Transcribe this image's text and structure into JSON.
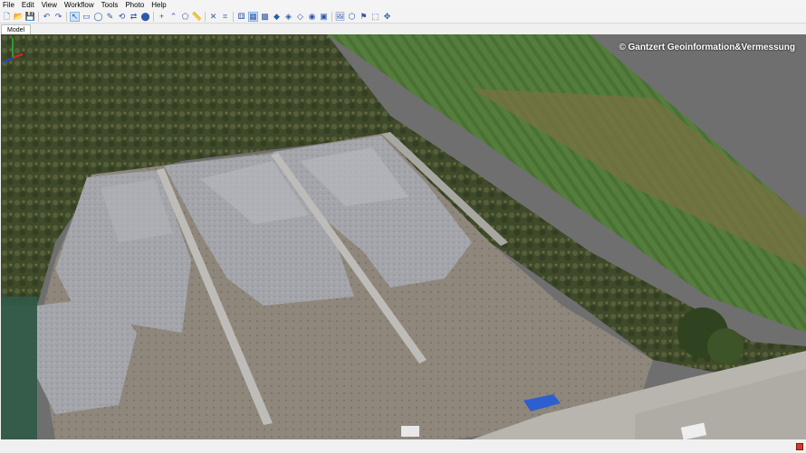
{
  "menu": {
    "items": [
      {
        "id": "file",
        "label": "File"
      },
      {
        "id": "edit",
        "label": "Edit"
      },
      {
        "id": "view",
        "label": "View"
      },
      {
        "id": "workflow",
        "label": "Workflow"
      },
      {
        "id": "tools",
        "label": "Tools"
      },
      {
        "id": "photo",
        "label": "Photo"
      },
      {
        "id": "help",
        "label": "Help"
      }
    ]
  },
  "toolbar": {
    "buttons": [
      {
        "name": "new-project-icon",
        "glyph": "🗋"
      },
      {
        "name": "open-project-icon",
        "glyph": "📂"
      },
      {
        "name": "save-project-icon",
        "glyph": "💾"
      },
      {
        "sep": true
      },
      {
        "name": "undo-icon",
        "glyph": "↶"
      },
      {
        "name": "redo-icon",
        "glyph": "↷"
      },
      {
        "sep": true
      },
      {
        "name": "navigation-icon",
        "glyph": "↖",
        "selected": true
      },
      {
        "name": "rectangle-selection-icon",
        "glyph": "▭"
      },
      {
        "name": "circle-selection-icon",
        "glyph": "◯"
      },
      {
        "name": "free-form-selection-icon",
        "glyph": "✎"
      },
      {
        "name": "move-object-icon",
        "glyph": "⟲"
      },
      {
        "name": "rotate-object-icon",
        "glyph": "⇄"
      },
      {
        "name": "scale-object-icon",
        "glyph": "⬤"
      },
      {
        "sep": true
      },
      {
        "name": "draw-point-icon",
        "glyph": "+"
      },
      {
        "name": "draw-polyline-icon",
        "glyph": "⌃"
      },
      {
        "name": "draw-polygon-icon",
        "glyph": "⬠"
      },
      {
        "name": "ruler-icon",
        "glyph": "📏"
      },
      {
        "sep": true
      },
      {
        "name": "delete-selection-icon",
        "glyph": "✕"
      },
      {
        "name": "crop-selection-icon",
        "glyph": "⌗"
      },
      {
        "sep": true
      },
      {
        "name": "show-cameras-icon",
        "glyph": "⚅"
      },
      {
        "name": "point-cloud-icon",
        "glyph": "▦",
        "selected": true
      },
      {
        "name": "dense-cloud-icon",
        "glyph": "▩"
      },
      {
        "name": "shaded-model-icon",
        "glyph": "◆"
      },
      {
        "name": "solid-model-icon",
        "glyph": "◈"
      },
      {
        "name": "wireframe-model-icon",
        "glyph": "◇"
      },
      {
        "name": "textured-model-icon",
        "glyph": "◉"
      },
      {
        "name": "tiled-model-icon",
        "glyph": "▣"
      },
      {
        "sep": true
      },
      {
        "name": "show-images-icon",
        "glyph": "🖼"
      },
      {
        "name": "show-shapes-icon",
        "glyph": "⬡"
      },
      {
        "name": "show-markers-icon",
        "glyph": "⚑"
      },
      {
        "name": "show-region-icon",
        "glyph": "⬚"
      },
      {
        "name": "reset-view-icon",
        "glyph": "✥"
      }
    ]
  },
  "tabs": [
    {
      "id": "model",
      "label": "Model"
    }
  ],
  "viewport": {
    "watermark": "© Gantzert Geoinformation&Vermessung"
  },
  "colors": {
    "field_green": "#4f7a3a",
    "field_brown": "#7a6a3f",
    "gravel_gray": "#9b9da3",
    "dirt": "#8d8579",
    "vegetation": "#3d4a2a",
    "road": "#b8b5b0",
    "blue_marker": "#2e5fd0"
  }
}
